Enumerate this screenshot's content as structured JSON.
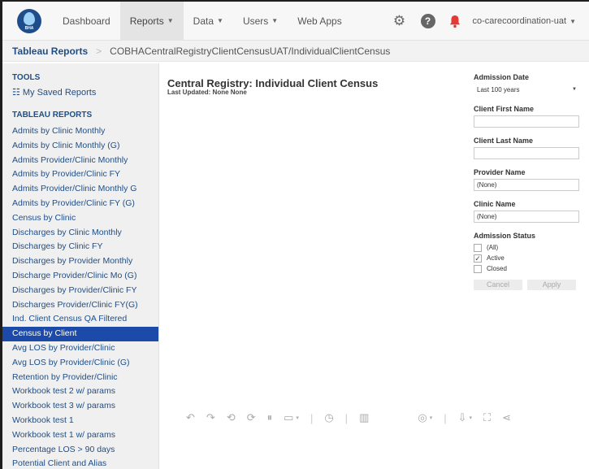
{
  "nav": {
    "logo_text": "BHA",
    "items": [
      {
        "label": "Dashboard",
        "caret": false,
        "active": false
      },
      {
        "label": "Reports",
        "caret": true,
        "active": true
      },
      {
        "label": "Data",
        "caret": true,
        "active": false
      },
      {
        "label": "Users",
        "caret": true,
        "active": false
      },
      {
        "label": "Web Apps",
        "caret": false,
        "active": false
      }
    ],
    "account": "co-carecoordination-uat",
    "help_glyph": "?",
    "icons": [
      "gear-icon",
      "help-icon",
      "bell-icon"
    ],
    "bell_color": "#e53935"
  },
  "breadcrumb": {
    "root": "Tableau Reports",
    "separator": ">",
    "path": "COBHACentralRegistryClientCensusUAT/IndividualClientCensus"
  },
  "sidebar": {
    "tools_heading": "TOOLS",
    "saved_reports": "My Saved Reports",
    "reports_heading": "TABLEAU REPORTS",
    "reports": [
      "Admits by Clinic Monthly",
      "Admits by Clinic Monthly (G)",
      "Admits Provider/Clinic Monthly",
      "Admits by Provider/Clinic FY",
      "Admits Provider/Clinic Monthly G",
      "Admits by Provider/Clinic FY (G)",
      "Census by Clinic",
      "Discharges by Clinic Monthly",
      "Discharges by Clinic FY",
      "Discharges by Provider Monthly",
      "Discharge Provider/Clinic Mo (G)",
      "Discharges by Provider/Clinic FY",
      "Discharges Provider/Clinic FY(G)",
      "Ind. Client Census QA Filtered",
      "Census by Client",
      "Avg LOS by Provider/Clinic",
      "Avg LOS by Provider/Clinic (G)",
      "Retention by Provider/Clinic",
      "Workbook test 2 w/ params",
      "Workbook test 3 w/ params",
      "Workbook test 1",
      "Workbook test 1 w/ params",
      "Percentage LOS > 90 days",
      "Potential Client and Alias"
    ],
    "selected_index": 14,
    "accent_color": "#1c4aa8"
  },
  "main": {
    "title": "Central Registry: Individual Client Census",
    "subtitle": "Last Updated: None None"
  },
  "filters": {
    "admission_date": {
      "label": "Admission Date",
      "value": "Last 100 years"
    },
    "first_name": {
      "label": "Client First Name",
      "value": ""
    },
    "last_name": {
      "label": "Client Last Name",
      "value": ""
    },
    "provider": {
      "label": "Provider Name",
      "value": "(None)"
    },
    "clinic": {
      "label": "Clinic Name",
      "value": "(None)"
    },
    "status": {
      "label": "Admission Status",
      "options": [
        {
          "label": "(All)",
          "checked": false
        },
        {
          "label": "Active",
          "checked": true
        },
        {
          "label": "Closed",
          "checked": false
        }
      ]
    },
    "cancel_label": "Cancel",
    "apply_label": "Apply"
  },
  "toolbar": {
    "icons": [
      "undo-icon",
      "redo-icon",
      "revert-icon",
      "refresh-icon",
      "pause-icon",
      "comment-icon",
      "metrics-icon",
      "view-data-icon",
      "watch-icon",
      "download-icon",
      "fullscreen-icon",
      "share-icon"
    ]
  }
}
